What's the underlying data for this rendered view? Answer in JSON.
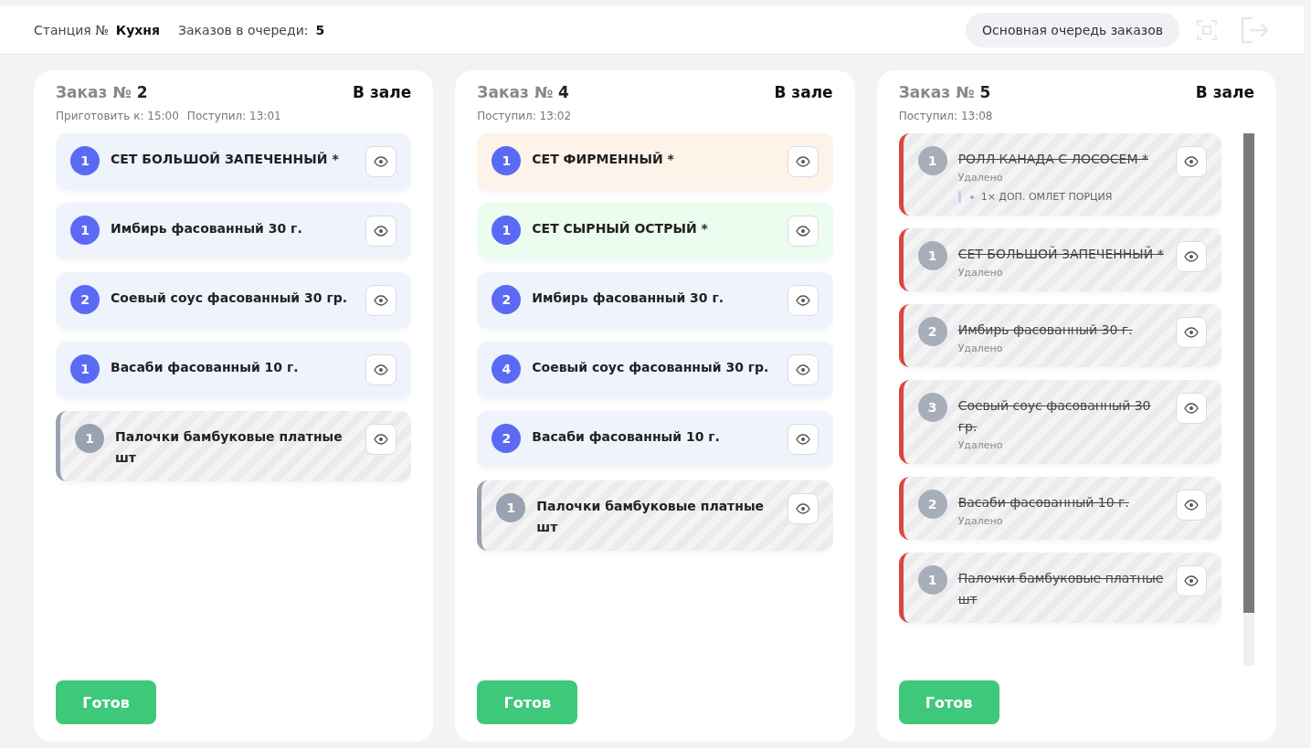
{
  "header": {
    "station_label": "Станция №",
    "station_name": "Кухня",
    "queue_label": "Заказов в очереди:",
    "queue_count": "5",
    "queue_button": "Основная очередь заказов"
  },
  "orders": [
    {
      "title": "Заказ №",
      "number": "2",
      "place": "В зале",
      "times": [
        "Приготовить к: 15:00",
        "Поступил: 13:01"
      ],
      "scrollbar": false,
      "items": [
        {
          "kind": "normal",
          "color": "#eff3fc",
          "qty": "1",
          "name": "СЕТ БОЛЬШОЙ ЗАПЕЧЕННЫЙ *"
        },
        {
          "kind": "normal",
          "color": "#eff3fc",
          "qty": "1",
          "name": "Имбирь фасованный 30 г."
        },
        {
          "kind": "normal",
          "color": "#eff3fc",
          "qty": "2",
          "name": "Соевый соус фасованный 30 гр."
        },
        {
          "kind": "normal",
          "color": "#eff3fc",
          "qty": "1",
          "name": "Васаби фасованный 10 г."
        },
        {
          "kind": "inactive",
          "qty": "1",
          "name": "Палочки бамбуковые платные шт"
        }
      ],
      "done_button": "Готов"
    },
    {
      "title": "Заказ №",
      "number": "4",
      "place": "В зале",
      "times": [
        "Поступил: 13:02"
      ],
      "scrollbar": false,
      "items": [
        {
          "kind": "normal",
          "color": "#fdf3e8",
          "qty": "1",
          "name": "СЕТ ФИРМЕННЫЙ *"
        },
        {
          "kind": "normal",
          "color": "#ecfcee",
          "qty": "1",
          "name": "СЕТ СЫРНЫЙ ОСТРЫЙ *"
        },
        {
          "kind": "normal",
          "color": "#eff3fc",
          "qty": "2",
          "name": "Имбирь фасованный 30 г."
        },
        {
          "kind": "normal",
          "color": "#eff3fc",
          "qty": "4",
          "name": "Соевый соус фасованный 30 гр."
        },
        {
          "kind": "normal",
          "color": "#eff3fc",
          "qty": "2",
          "name": "Васаби фасованный 10 г."
        },
        {
          "kind": "inactive",
          "qty": "1",
          "name": "Палочки бамбуковые платные шт"
        }
      ],
      "done_button": "Готов"
    },
    {
      "title": "Заказ №",
      "number": "5",
      "place": "В зале",
      "times": [
        "Поступил: 13:08"
      ],
      "scrollbar": true,
      "items": [
        {
          "kind": "deleted",
          "qty": "1",
          "name": "РОЛЛ КАНАДА С ЛОСОСЕМ *",
          "status": "Удалено",
          "modifiers": [
            "1× ДОП. ОМЛЕТ ПОРЦИЯ"
          ]
        },
        {
          "kind": "deleted",
          "qty": "1",
          "name": "СЕТ БОЛЬШОЙ ЗАПЕЧЕННЫЙ *",
          "status": "Удалено"
        },
        {
          "kind": "deleted",
          "qty": "2",
          "name": "Имбирь фасованный 30 г.",
          "status": "Удалено"
        },
        {
          "kind": "deleted",
          "qty": "3",
          "name": "Соевый соус фасованный 30 гр.",
          "status": "Удалено"
        },
        {
          "kind": "deleted",
          "qty": "2",
          "name": "Васаби фасованный 10 г.",
          "status": "Удалено"
        },
        {
          "kind": "deleted",
          "qty": "1",
          "name": "Палочки бамбуковые платные шт"
        }
      ],
      "done_button": "Готов"
    }
  ]
}
